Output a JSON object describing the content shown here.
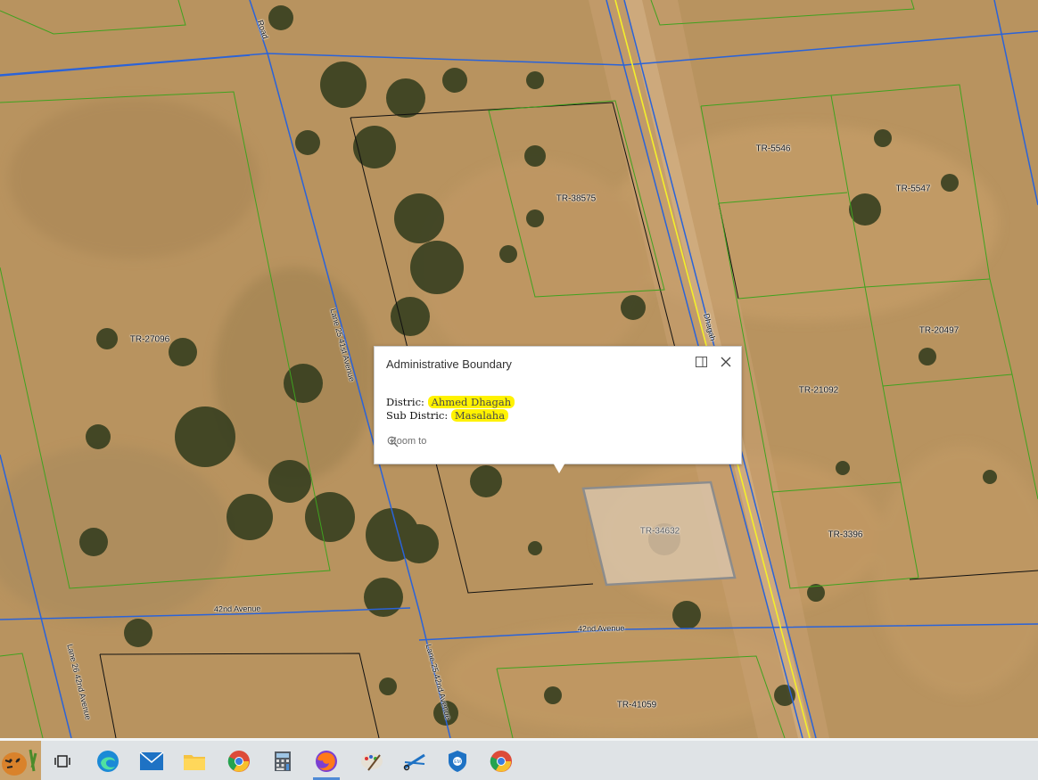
{
  "popup": {
    "title": "Administrative Boundary",
    "district_label": "Distric:",
    "district_value": "Ahmed Dhagah",
    "subdistrict_label": "Sub Distric:",
    "subdistrict_value": "Masalaha",
    "zoom_label": "Zoom to"
  },
  "parcels": {
    "p27096": "TR-27096",
    "p38575": "TR-38575",
    "p5546": "TR-5546",
    "p5547": "TR-5547",
    "p20497": "TR-20497",
    "p21092": "TR-21092",
    "p34632": "TR-34632",
    "p3396": "TR-3396",
    "p41059": "TR-41059"
  },
  "roads": {
    "r_42nd_left": "42nd Avenue",
    "r_42nd_right": "42nd Avenue",
    "r_lane25": "Lane 25 41st Avenue",
    "r_lane25b": "Lane 25 42nd Avenue",
    "r_lane26": "Lane 26 42nd Avenue",
    "r_dhagah": "Dhagah",
    "r_top": "Road"
  },
  "taskbar": {
    "apps": [
      "tiger-avatar",
      "task-view",
      "edge",
      "mail",
      "file-explorer",
      "chrome",
      "calculator",
      "firefox",
      "paint",
      "snipping-tool",
      "defender",
      "chrome"
    ],
    "active_app": "firefox"
  },
  "colors": {
    "parcel_outline": "#3fa21f",
    "road_line": "#2a63d9",
    "boundary_line": "#111111",
    "highlight": "#fff200",
    "selected_parcel_fill": "#d8c3a8"
  }
}
